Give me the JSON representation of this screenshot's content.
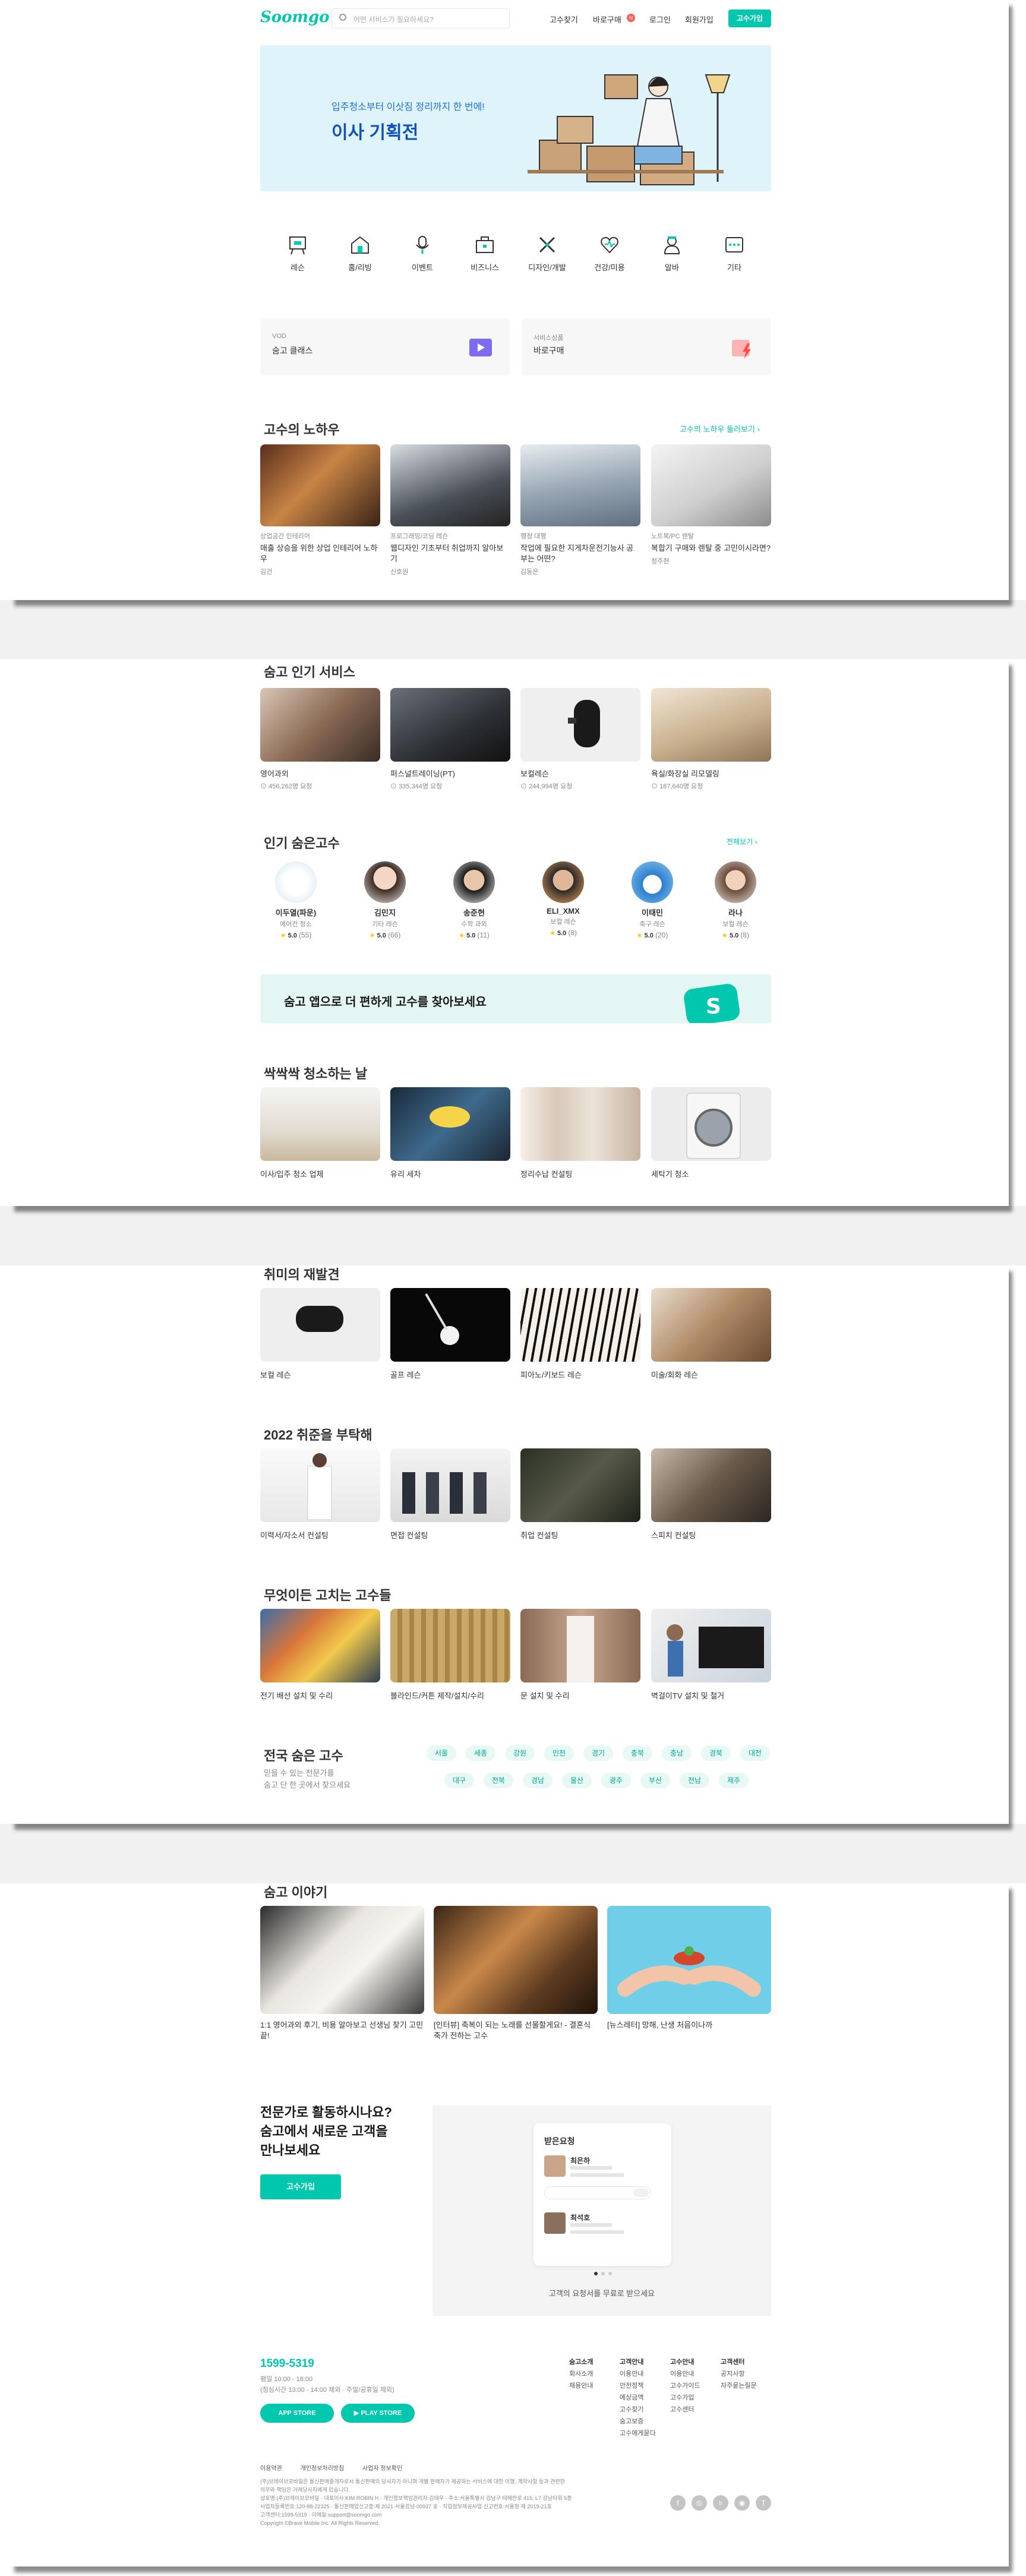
{
  "header": {
    "logo": "Soomgo",
    "search_placeholder": "어떤 서비스가 필요하세요?",
    "nav": [
      "고수찾기",
      "바로구매",
      "로그인",
      "회원가입"
    ],
    "nav_badge": "N",
    "cta": "고수가입"
  },
  "hero": {
    "subtitle": "입주청소부터 이삿짐 정리까지 한 번에!",
    "title": "이사 기획전"
  },
  "categories": [
    "레슨",
    "홈/리빙",
    "이벤트",
    "비즈니스",
    "디자인/개발",
    "건강/미용",
    "알바",
    "기타"
  ],
  "promo": [
    {
      "small": "VOD",
      "title": "숨고 클래스"
    },
    {
      "small": "서비스상품",
      "title": "바로구매"
    }
  ],
  "knowhow": {
    "title": "고수의 노하우",
    "more": "고수의 노하우 둘러보기",
    "items": [
      {
        "cat": "상업공간 인테리어",
        "title": "매출 상승을 위한 상업 인테리어 노하우",
        "author": "김건"
      },
      {
        "cat": "프로그래밍/코딩 레슨",
        "title": "웹디자인 기초부터 취업까지 알아보기",
        "author": "신호원"
      },
      {
        "cat": "행정 대행",
        "title": "작업에 필요한 지게차운전기능사 공부는 어떤?",
        "author": "김동은"
      },
      {
        "cat": "노트북/PC 렌탈",
        "title": "복합기 구매와 렌탈 중 고민이시라면?",
        "author": "정주현"
      }
    ]
  },
  "popular": {
    "title": "숨고 인기 서비스",
    "items": [
      {
        "name": "영어과외",
        "count": "456,262명 요청"
      },
      {
        "name": "퍼스널트레이닝(PT)",
        "count": "335,344명 요청"
      },
      {
        "name": "보컬레슨",
        "count": "244,994명 요청"
      },
      {
        "name": "욕실/화장실 리모델링",
        "count": "187,640명 요청"
      }
    ]
  },
  "pros": {
    "title": "인기 숨은고수",
    "more": "전체보기",
    "items": [
      {
        "name": "이두열(파운)",
        "service": "에어컨 청소",
        "rating": "5.0",
        "reviews": "(55)"
      },
      {
        "name": "김민지",
        "service": "기타 레슨",
        "rating": "5.0",
        "reviews": "(66)"
      },
      {
        "name": "송준현",
        "service": "수학 과외",
        "rating": "5.0",
        "reviews": "(11)"
      },
      {
        "name": "ELI_XMX",
        "service": "보컬 레슨",
        "rating": "5.0",
        "reviews": "(8)"
      },
      {
        "name": "이태민",
        "service": "축구 레슨",
        "rating": "5.0",
        "reviews": "(20)"
      },
      {
        "name": "라나",
        "service": "보컬 레슨",
        "rating": "5.0",
        "reviews": "(8)"
      }
    ]
  },
  "app_banner": {
    "text": "숨고 앱으로 더 편하게 고수를 찾아보세요"
  },
  "cleaning": {
    "title": "싹싹싹 청소하는 날",
    "items": [
      "이사/입주 청소 업체",
      "유리 세차",
      "정리수납 컨설팅",
      "세탁기 청소"
    ]
  },
  "hobby": {
    "title": "취미의 재발견",
    "items": [
      "보컬 레슨",
      "골프 레슨",
      "피아노/키보드 레슨",
      "미술/회화 레슨"
    ]
  },
  "job": {
    "title": "2022 취준을 부탁해",
    "items": [
      "이력서/자소서 컨설팅",
      "면접 컨설팅",
      "취업 컨설팅",
      "스피치 컨설팅"
    ]
  },
  "fix": {
    "title": "무엇이든 고치는 고수들",
    "items": [
      "전기 배선 설치 및 수리",
      "블라인드/커튼 제작/설치/수리",
      "문 설치 및 수리",
      "벽걸이TV 설치 및 철거"
    ]
  },
  "regions": {
    "title": "전국 숨은 고수",
    "desc1": "믿을 수 있는 전문가를",
    "desc2": "숨고 단 한 곳에서 찾으세요",
    "row1": [
      "서울",
      "세종",
      "강원",
      "인천",
      "경기",
      "충북",
      "충남",
      "경북",
      "대전"
    ],
    "row2": [
      "대구",
      "전북",
      "경남",
      "울산",
      "광주",
      "부산",
      "전남",
      "제주"
    ]
  },
  "stories": {
    "title": "숨고 이야기",
    "items": [
      "1:1 영어과외 후기, 비용 알아보고 선생님 찾기 고민 끝!",
      "[인터뷰] 축복이 되는 노래를 선물할게요! - 결혼식 축가 전하는 고수",
      "[뉴스레터] 망해, 난생 처음이나까"
    ]
  },
  "pro_cta": {
    "line1": "전문가로 활동하시나요?",
    "line2": "숨고에서 새로운 고객을",
    "line3": "만나보세요",
    "button": "고수가입",
    "card_title": "받은요청",
    "card_name1": "최은하",
    "card_name2": "최석호",
    "caption": "고객의 요청서를 무료로 받으세요"
  },
  "footer": {
    "phone": "1599-5319",
    "hours1": "평일 10:00 - 18:00",
    "hours2": "(점심시간 13:00 - 14:00 제외 · 주말/공휴일 제외)",
    "app_store": "APP STORE",
    "play_store": "PLAY STORE",
    "cols": [
      {
        "head": "숨고소개",
        "links": [
          "회사소개",
          "채용안내"
        ]
      },
      {
        "head": "고객안내",
        "links": [
          "이용안내",
          "안전정책",
          "예상금액",
          "고수찾기",
          "숨고보증",
          "고수에게묻다"
        ]
      },
      {
        "head": "고수안내",
        "links": [
          "이용안내",
          "고수가이드",
          "고수가입",
          "고수센터"
        ]
      },
      {
        "head": "고객센터",
        "links": [
          "공지사항",
          "자주묻는질문"
        ]
      }
    ],
    "legal": [
      "이용약관",
      "개인정보처리방침",
      "사업자 정보확인"
    ],
    "info1": "(주)브레이브모바일은 통신판매중개자로서 통신판매의 당사자가 아니며 개별 판매자가 제공하는 서비스에 대한 이행, 계약사항 등과 관련한",
    "info2": "의무와 책임은 거래당사자에게 있습니다.",
    "info3": "상호명:(주)브레이브모바일 · 대표이사:KIM ROBIN H · 개인정보책임관리자:김태우 · 주소:서울특별시 강남구 테헤란로 415, L7 강남타워 5층",
    "info4": "사업자등록번호:120-88-22325 · 통신판매업신고증:제 2021-서울강남-00937 호 · 직업정보제공사업 신고번호:서울청 제 2019-21호",
    "info5": "고객센터:1599-5319 · 이메일:support@soomgo.com",
    "copyright": "Copyright ©Brave Mobile Inc. All Rights Reserved."
  },
  "colors": {
    "accent": "#00c7ae",
    "hero_bg": "#dff4fa",
    "text": "#323232"
  }
}
